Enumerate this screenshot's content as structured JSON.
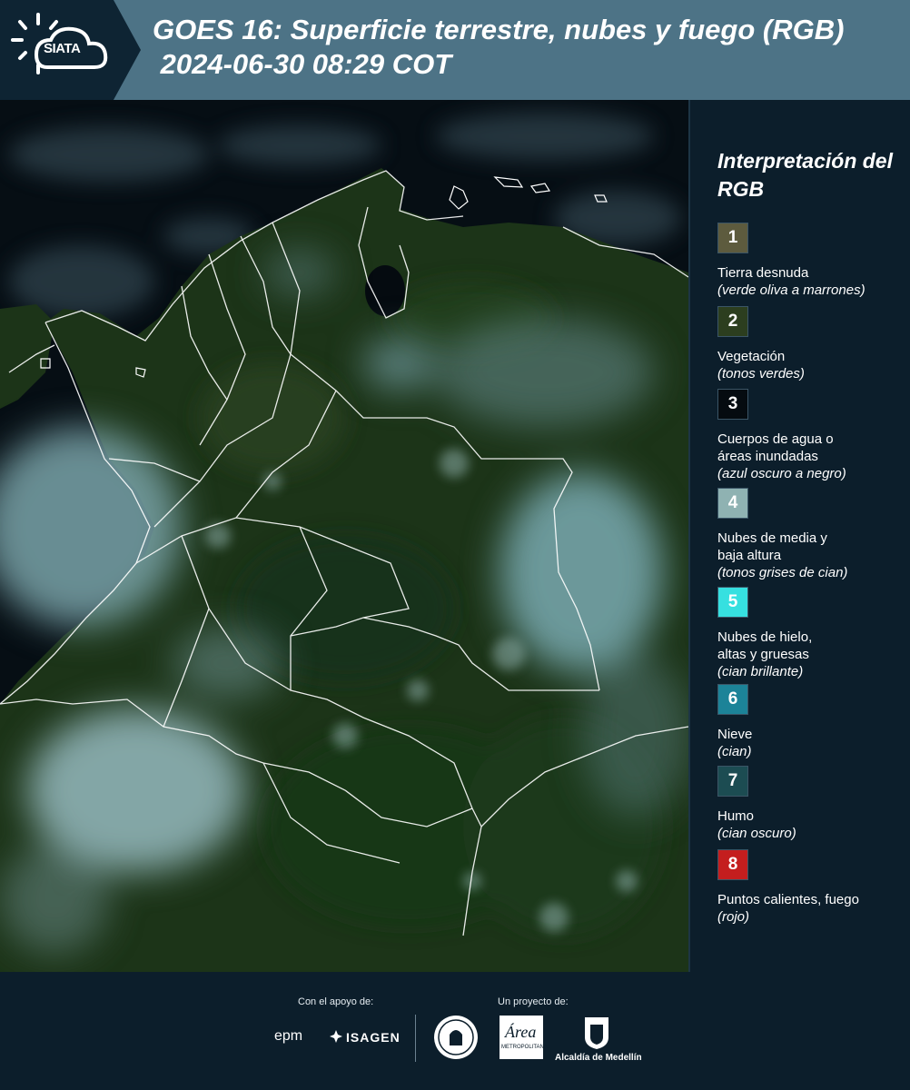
{
  "header": {
    "logo_text": "SIATA",
    "title_line1": "GOES 16: Superficie terrestre, nubes y fuego (RGB)",
    "title_line2": " 2024-06-30 08:29 COT"
  },
  "map": {
    "kind": "satellite-rgb-composite",
    "region_shown": "Colombia and neighboring areas",
    "border_color": "#ffffff"
  },
  "legend": {
    "title": "Interpretación del RGB",
    "items": [
      {
        "num": "1",
        "label": "Tierra desnuda",
        "note": "(verde oliva a marrones)",
        "color": "#5d5b3e"
      },
      {
        "num": "2",
        "label": "Vegetación",
        "note": "(tonos verdes)",
        "color": "#2c3e1f"
      },
      {
        "num": "3",
        "label": "Cuerpos de agua o áreas inundadas",
        "note": "(azul oscuro a negro)",
        "color": "#050b10"
      },
      {
        "num": "4",
        "label": "Nubes de media y baja altura",
        "note": "(tonos grises de cian)",
        "color": "#8fb2b2"
      },
      {
        "num": "5",
        "label": "Nubes de hielo, altas y gruesas",
        "note": "(cian brillante)",
        "color": "#36e0e0"
      },
      {
        "num": "6",
        "label": "Nieve",
        "note": "(cian)",
        "color": "#1c8398"
      },
      {
        "num": "7",
        "label": "Humo",
        "note": "(cian oscuro)",
        "color": "#1c4c52"
      },
      {
        "num": "8",
        "label": "Puntos calientes, fuego",
        "note": "(rojo)",
        "color": "#c41e1e"
      }
    ]
  },
  "footer": {
    "support_caption": "Con el apoyo de:",
    "project_caption": "Un proyecto de:",
    "epm": "epm",
    "isagen": "ISAGEN",
    "area_metro": "Área",
    "area_metro_sub": "METROPOLITANA",
    "alcaldia": "Alcaldía de Medellín"
  }
}
